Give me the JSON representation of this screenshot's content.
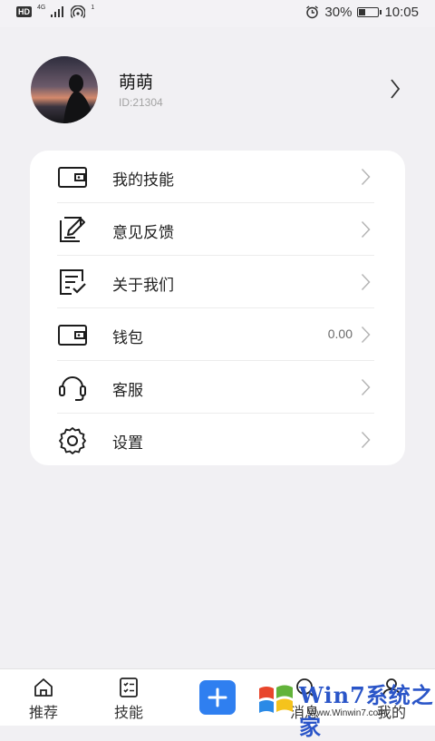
{
  "status_bar": {
    "hd": "HD",
    "network": "4G",
    "hotspot_count": "1",
    "battery": "30%",
    "time": "10:05"
  },
  "profile": {
    "name": "萌萌",
    "id_text": "ID:21304"
  },
  "menu": {
    "items": [
      {
        "label": "我的技能",
        "icon": "wallet-icon"
      },
      {
        "label": "意见反馈",
        "icon": "edit-note-icon"
      },
      {
        "label": "关于我们",
        "icon": "checklist-icon"
      },
      {
        "label": "钱包",
        "icon": "wallet-icon",
        "value": "0.00"
      },
      {
        "label": "客服",
        "icon": "headset-icon"
      },
      {
        "label": "设置",
        "icon": "gear-icon"
      }
    ]
  },
  "tab_bar": {
    "tabs": [
      {
        "label": "推荐",
        "icon": "home-icon"
      },
      {
        "label": "技能",
        "icon": "list-icon"
      },
      {
        "label": "",
        "icon": "plus-icon"
      },
      {
        "label": "消息",
        "icon": "message-icon"
      },
      {
        "label": "我的",
        "icon": "user-icon"
      }
    ]
  },
  "watermark": {
    "brand": "Win7系统之家",
    "url": "Www.Winwin7.com"
  },
  "colors": {
    "background": "#f1f0f3",
    "card": "#ffffff",
    "accent": "#2f7ff0"
  }
}
